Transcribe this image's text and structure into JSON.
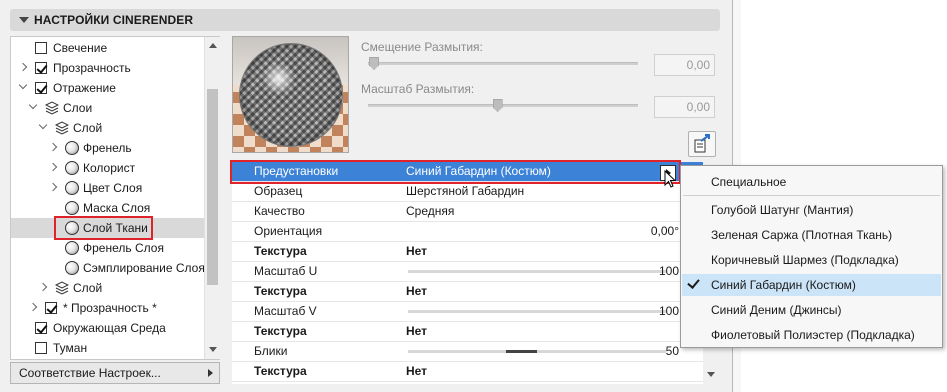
{
  "header": {
    "title": "НАСТРОЙКИ CINERENDER"
  },
  "tree": {
    "items": [
      {
        "label": "Свечение",
        "checked": false,
        "expander": "none",
        "icon": "checkbox"
      },
      {
        "label": "Прозрачность",
        "checked": true,
        "expander": "collapsed",
        "icon": "checkbox"
      },
      {
        "label": "Отражение",
        "checked": true,
        "expander": "expanded",
        "icon": "checkbox"
      },
      {
        "label": "Слои",
        "expander": "expanded",
        "icon": "layers-icon"
      },
      {
        "label": "Слой",
        "expander": "expanded",
        "icon": "layers-icon"
      },
      {
        "label": "Френель",
        "expander": "collapsed",
        "icon": "sphere-icon"
      },
      {
        "label": "Колорист",
        "expander": "collapsed",
        "icon": "sphere-icon"
      },
      {
        "label": "Цвет Слоя",
        "expander": "collapsed",
        "icon": "sphere-icon"
      },
      {
        "label": "Маска Слоя",
        "expander": "none",
        "icon": "sphere-icon"
      },
      {
        "label": "Слой Ткани",
        "expander": "none",
        "icon": "sphere-icon",
        "selected": true
      },
      {
        "label": "Френель Слоя",
        "expander": "none",
        "icon": "sphere-icon"
      },
      {
        "label": "Сэмплирование Слоя",
        "expander": "none",
        "icon": "sphere-icon"
      },
      {
        "label": "Слой",
        "expander": "collapsed",
        "icon": "layers-icon"
      },
      {
        "label": "* Прозрачность *",
        "checked": true,
        "expander": "collapsed",
        "icon": "checkbox"
      },
      {
        "label": "Окружающая Среда",
        "checked": true,
        "expander": "none",
        "icon": "checkbox"
      },
      {
        "label": "Туман",
        "checked": false,
        "expander": "none",
        "icon": "checkbox"
      }
    ]
  },
  "match_dropdown": {
    "label": "Соответствие Настроек..."
  },
  "blur_offset": {
    "label": "Смещение Размытия:",
    "value": "0,00"
  },
  "blur_scale": {
    "label": "Масштаб Размытия:",
    "value": "0,00",
    "level": 0.48
  },
  "grid": {
    "rows": [
      {
        "key": "Предустановки",
        "value": "Синий Габардин (Костюм)",
        "selected": true
      },
      {
        "key": "Образец",
        "value": "Шерстяной Габардин"
      },
      {
        "key": "Качество",
        "value": "Средняя"
      },
      {
        "key": "Ориентация",
        "value": "",
        "number": "0,00°"
      },
      {
        "key": "Текстура",
        "value": "Нет",
        "bold": true
      },
      {
        "key": "Масштаб U",
        "value": "",
        "number": "100",
        "bar": 1.0
      },
      {
        "key": "Текстура",
        "value": "Нет",
        "bold": true
      },
      {
        "key": "Масштаб V",
        "value": "",
        "number": "100",
        "bar": 1.0
      },
      {
        "key": "Текстура",
        "value": "Нет",
        "bold": true
      },
      {
        "key": "Блики",
        "value": "",
        "number": "50",
        "bar": 0.5
      },
      {
        "key": "Текстура",
        "value": "Нет",
        "bold": true
      }
    ]
  },
  "menu": {
    "header_item": "Специальное",
    "items": [
      "Голубой Шатунг (Мантия)",
      "Зеленая Саржа (Плотная Ткань)",
      "Коричневый Шармез (Подкладка)",
      "Синий Габардин (Костюм)",
      "Синий Деним (Джинсы)",
      "Фиолетовый Полиэстер (Подкладка)"
    ],
    "checked_index": 3
  },
  "colors": {
    "selection": "#3c83d8",
    "highlight": "#e0232a",
    "menu_hover": "#cce4f7"
  }
}
